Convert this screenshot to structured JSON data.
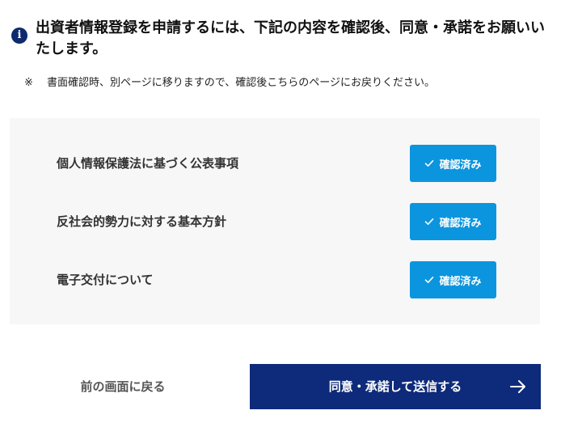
{
  "notice": {
    "icon": "info-icon",
    "title": "出資者情報登録を申請するには、下記の内容を確認後、同意・承諾をお願いいたします。",
    "note_mark": "※",
    "note_text": "書面確認時、別ページに移りますので、確認後こちらのページにお戻りください。"
  },
  "checks": {
    "items": [
      {
        "label": "個人情報保護法に基づく公表事項",
        "button_label": "確認済み",
        "icon": "check-icon"
      },
      {
        "label": "反社会的勢力に対する基本方針",
        "button_label": "確認済み",
        "icon": "check-icon"
      },
      {
        "label": "電子交付について",
        "button_label": "確認済み",
        "icon": "check-icon"
      }
    ]
  },
  "actions": {
    "back_label": "前の画面に戻る",
    "submit_label": "同意・承諾して送信する",
    "submit_icon": "arrow-right-icon"
  },
  "colors": {
    "primary_navy": "#0e2a7a",
    "confirm_blue": "#0b95de",
    "panel_bg": "#f7f7f7"
  }
}
